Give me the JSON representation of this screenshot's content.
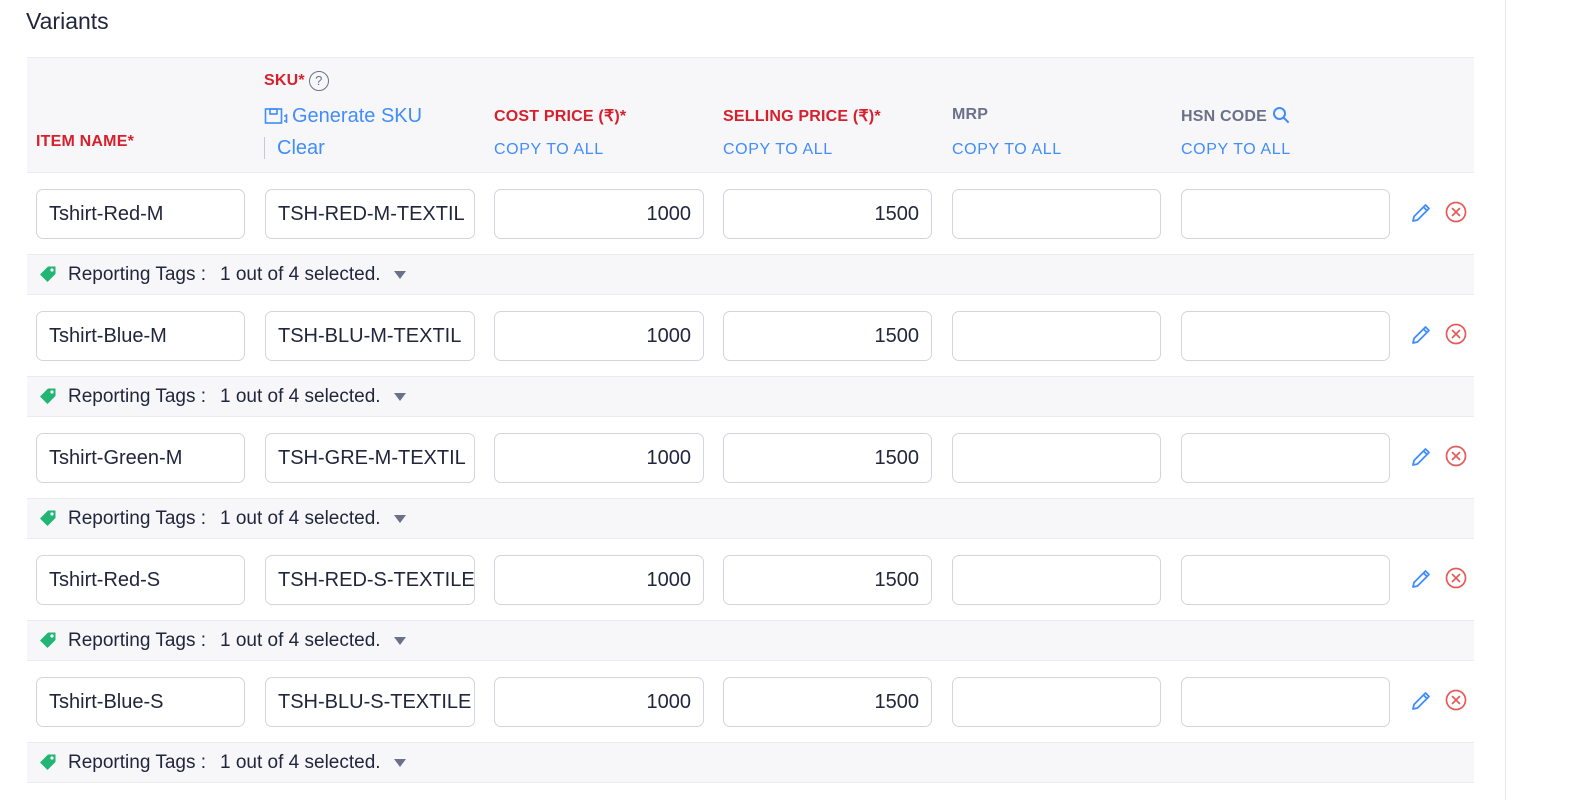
{
  "section_title": "Variants",
  "header": {
    "item_name": "ITEM NAME*",
    "sku": "SKU*",
    "sku_help": "?",
    "generate_sku": "Generate SKU",
    "clear": "Clear",
    "cost_price": "COST PRICE (₹)*",
    "selling_price": "SELLING PRICE (₹)*",
    "mrp": "MRP",
    "hsn_code": "HSN CODE",
    "copy_to_all": "COPY TO ALL"
  },
  "colors": {
    "required": "#d6202b",
    "link": "#408dfb",
    "tag": "#22b573",
    "delete": "#e85a5a"
  },
  "tags_label": "Reporting Tags :",
  "variants": [
    {
      "item_name": "Tshirt-Red-M",
      "sku": "TSH-RED-M-TEXTIL",
      "cost_price": "1000",
      "selling_price": "1500",
      "mrp": "",
      "hsn_code": "",
      "tags": "1 out of 4 selected."
    },
    {
      "item_name": "Tshirt-Blue-M",
      "sku": "TSH-BLU-M-TEXTIL",
      "cost_price": "1000",
      "selling_price": "1500",
      "mrp": "",
      "hsn_code": "",
      "tags": "1 out of 4 selected."
    },
    {
      "item_name": "Tshirt-Green-M",
      "sku": "TSH-GRE-M-TEXTIL",
      "cost_price": "1000",
      "selling_price": "1500",
      "mrp": "",
      "hsn_code": "",
      "tags": "1 out of 4 selected."
    },
    {
      "item_name": "Tshirt-Red-S",
      "sku": "TSH-RED-S-TEXTILE",
      "cost_price": "1000",
      "selling_price": "1500",
      "mrp": "",
      "hsn_code": "",
      "tags": "1 out of 4 selected."
    },
    {
      "item_name": "Tshirt-Blue-S",
      "sku": "TSH-BLU-S-TEXTILE",
      "cost_price": "1000",
      "selling_price": "1500",
      "mrp": "",
      "hsn_code": "",
      "tags": "1 out of 4 selected."
    }
  ]
}
